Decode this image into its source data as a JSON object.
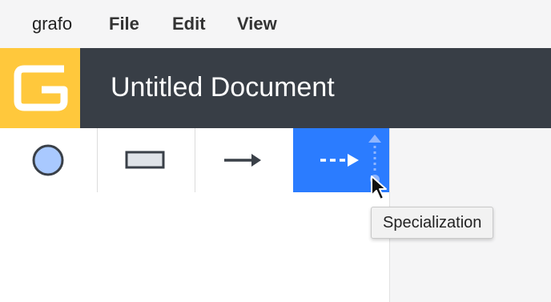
{
  "menubar": {
    "app_name": "grafo",
    "items": [
      "File",
      "Edit",
      "View"
    ]
  },
  "header": {
    "title": "Untitled Document",
    "logo_letter_icon": "g-logo-icon",
    "background": "#383e46",
    "logo_color": "#ffc83c"
  },
  "toolbar": {
    "tools": [
      {
        "name": "circle-tool",
        "icon": "circle-node-icon"
      },
      {
        "name": "rectangle-tool",
        "icon": "rectangle-node-icon"
      },
      {
        "name": "arrow-tool",
        "icon": "solid-arrow-icon"
      },
      {
        "name": "specialization-tool",
        "icon": "dashed-arrow-icon",
        "active": true
      }
    ],
    "active_color": "#2b7cff"
  },
  "tooltip": {
    "text": "Specialization"
  }
}
